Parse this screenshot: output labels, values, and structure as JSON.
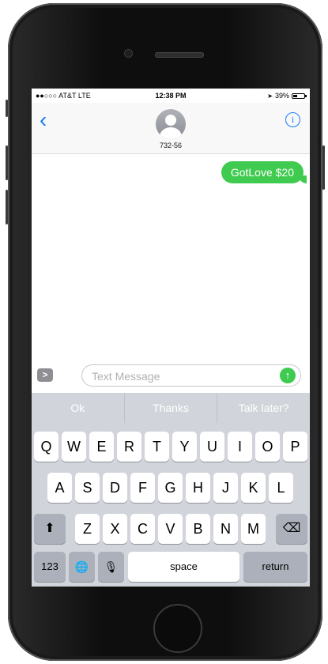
{
  "status_bar": {
    "carrier": "●●○○○ AT&T  LTE",
    "time": "12:38 PM",
    "battery": "39%"
  },
  "battery_level": 0.39,
  "header": {
    "back": "‹",
    "contact": "732-56",
    "info": "i"
  },
  "messages": [
    {
      "text": "GotLove $20",
      "from": "me"
    }
  ],
  "composer": {
    "apps": ">",
    "placeholder": "Text Message",
    "send": "↑"
  },
  "suggestions": [
    "Ok",
    "Thanks",
    "Talk later?"
  ],
  "keys": {
    "row1": [
      "Q",
      "W",
      "E",
      "R",
      "T",
      "Y",
      "U",
      "I",
      "O",
      "P"
    ],
    "row2": [
      "A",
      "S",
      "D",
      "F",
      "G",
      "H",
      "J",
      "K",
      "L"
    ],
    "row3": [
      "Z",
      "X",
      "C",
      "V",
      "B",
      "N",
      "M"
    ],
    "shift": "⬆",
    "delete": "⌫",
    "numbers": "123",
    "globe": "🌐",
    "mic": "🎙",
    "space": "space",
    "return": "return"
  },
  "colors": {
    "accent": "#1a7cf5",
    "bubble": "#3fcb4f",
    "keyboard": "#d1d4da"
  }
}
